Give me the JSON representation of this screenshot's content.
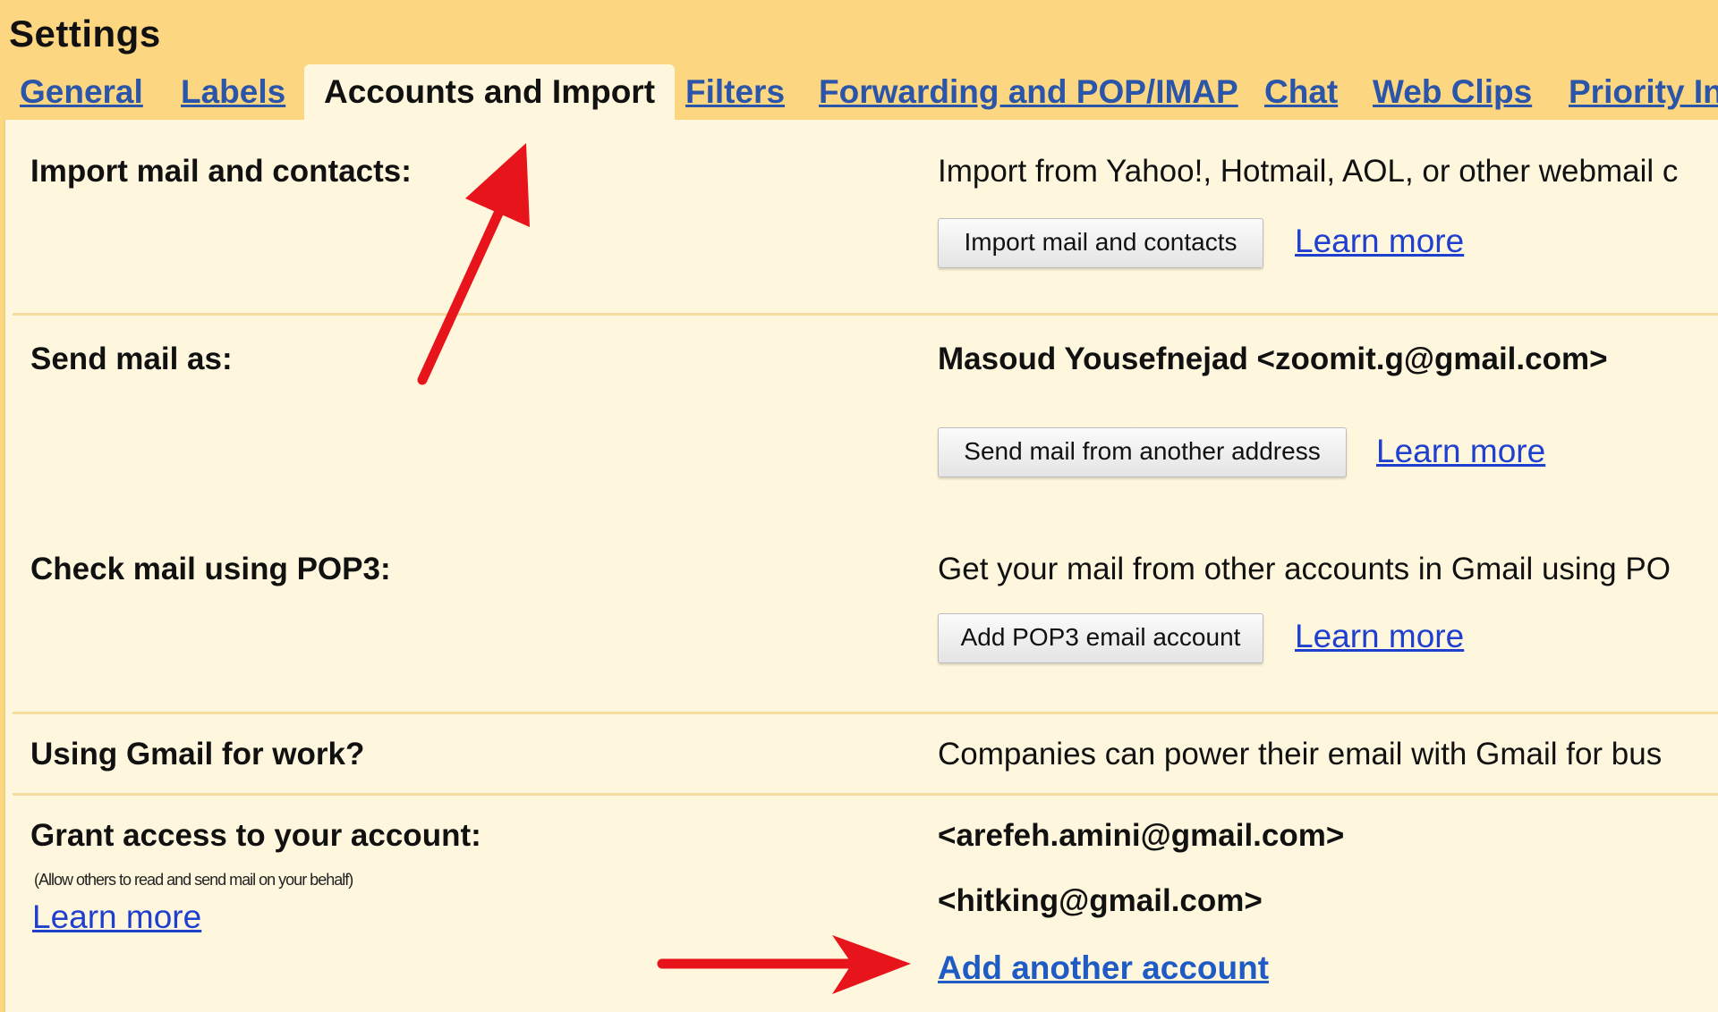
{
  "page": {
    "title": "Settings"
  },
  "tabs": [
    {
      "label": "General"
    },
    {
      "label": "Labels"
    },
    {
      "label": "Accounts and Import"
    },
    {
      "label": "Filters"
    },
    {
      "label": "Forwarding and POP/IMAP"
    },
    {
      "label": "Chat"
    },
    {
      "label": "Web Clips"
    },
    {
      "label": "Priority In"
    }
  ],
  "import": {
    "label": "Import mail and contacts:",
    "description": "Import from Yahoo!, Hotmail, AOL, or other webmail c",
    "button": "Import mail and contacts",
    "learn_more": "Learn more"
  },
  "send_as": {
    "label": "Send mail as:",
    "address": "Masoud Yousefnejad <zoomit.g@gmail.com>",
    "button": "Send mail from another address",
    "learn_more": "Learn more"
  },
  "pop3": {
    "label": "Check mail using POP3:",
    "description": "Get your mail from other accounts in Gmail using PO",
    "button": "Add POP3 email account",
    "learn_more": "Learn more"
  },
  "work": {
    "label": "Using Gmail for work?",
    "description": "Companies can power their email with Gmail for bus"
  },
  "grant": {
    "label": "Grant access to your account:",
    "note": "(Allow others to read and send mail on your behalf)",
    "learn_more": "Learn more",
    "accounts": [
      "<arefeh.amini@gmail.com>",
      "<hitking@gmail.com>"
    ],
    "add_link": "Add another account"
  },
  "annotation_color": "#e8141b"
}
